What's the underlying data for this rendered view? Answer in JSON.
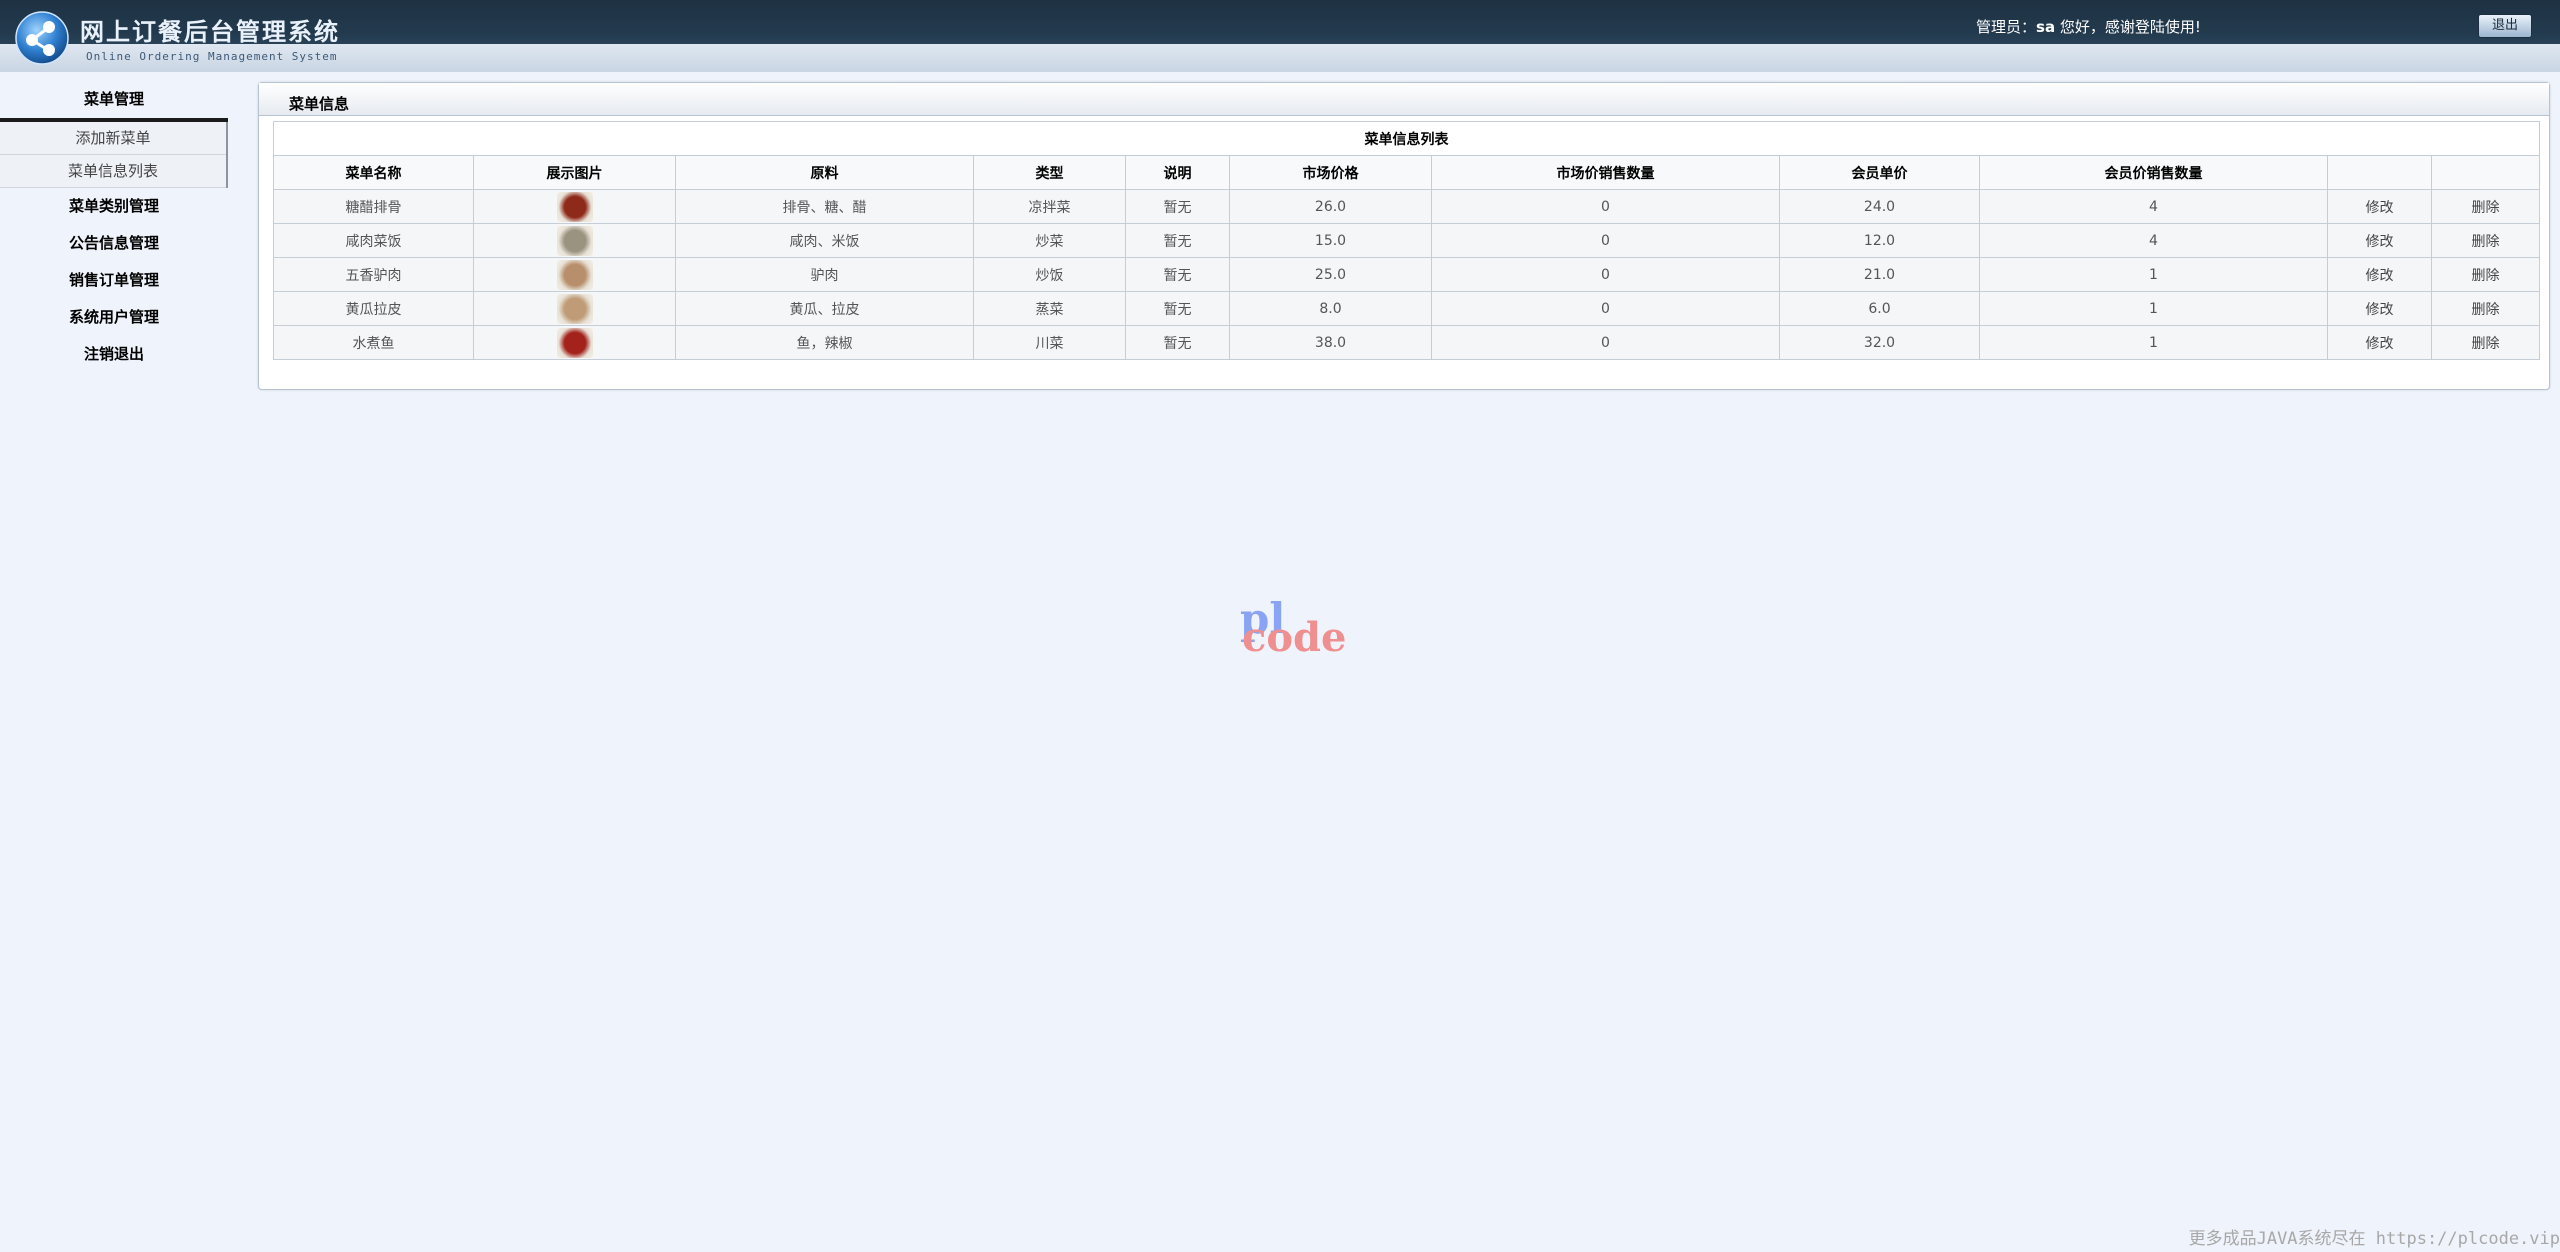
{
  "header": {
    "title": "网上订餐后台管理系统",
    "subtitle": "Online Ordering Management System",
    "welcome_prefix": "管理员：",
    "user": "sa",
    "welcome_suffix": " 您好，感谢登陆使用!",
    "logout_label": "退出"
  },
  "sidebar": {
    "section_title": "菜单管理",
    "sub_items": [
      {
        "label": "添加新菜单"
      },
      {
        "label": "菜单信息列表"
      }
    ],
    "items": [
      {
        "label": "菜单类别管理"
      },
      {
        "label": "公告信息管理"
      },
      {
        "label": "销售订单管理"
      },
      {
        "label": "系统用户管理"
      },
      {
        "label": "注销退出"
      }
    ]
  },
  "panel": {
    "title": "菜单信息",
    "table_caption": "菜单信息列表",
    "columns": [
      "菜单名称",
      "展示图片",
      "原料",
      "类型",
      "说明",
      "市场价格",
      "市场价销售数量",
      "会员单价",
      "会员价销售数量",
      "",
      ""
    ],
    "rows": [
      {
        "name": "糖醋排骨",
        "image": "糖醋排骨",
        "ingredients": "排骨、糖、醋",
        "type": "凉拌菜",
        "desc": "暂无",
        "market_price": "26.0",
        "market_sales": "0",
        "member_price": "24.0",
        "member_sales": "4",
        "edit": "修改",
        "delete": "删除"
      },
      {
        "name": "咸肉菜饭",
        "image": "咸肉菜饭",
        "ingredients": "咸肉、米饭",
        "type": "炒菜",
        "desc": "暂无",
        "market_price": "15.0",
        "market_sales": "0",
        "member_price": "12.0",
        "member_sales": "4",
        "edit": "修改",
        "delete": "删除"
      },
      {
        "name": "五香驴肉",
        "image": "五香驴肉",
        "ingredients": "驴肉",
        "type": "炒饭",
        "desc": "暂无",
        "market_price": "25.0",
        "market_sales": "0",
        "member_price": "21.0",
        "member_sales": "1",
        "edit": "修改",
        "delete": "删除"
      },
      {
        "name": "黄瓜拉皮",
        "image": "黄瓜拉皮",
        "ingredients": "黄瓜、拉皮",
        "type": "蒸菜",
        "desc": "暂无",
        "market_price": "8.0",
        "market_sales": "0",
        "member_price": "6.0",
        "member_sales": "1",
        "edit": "修改",
        "delete": "删除"
      },
      {
        "name": "水煮鱼",
        "image": "水煮鱼",
        "ingredients": "鱼，辣椒",
        "type": "川菜",
        "desc": "暂无",
        "market_price": "38.0",
        "market_sales": "0",
        "member_price": "32.0",
        "member_sales": "1",
        "edit": "修改",
        "delete": "删除"
      }
    ]
  },
  "thumb_colors": [
    "#8e2a1a",
    "#9a9380",
    "#b88f6c",
    "#bf9c77",
    "#a3221c"
  ],
  "watermark": {
    "part1": "pl",
    "part2": "code"
  },
  "footer_note": "更多成品JAVA系统尽在 https://plcode.vip"
}
